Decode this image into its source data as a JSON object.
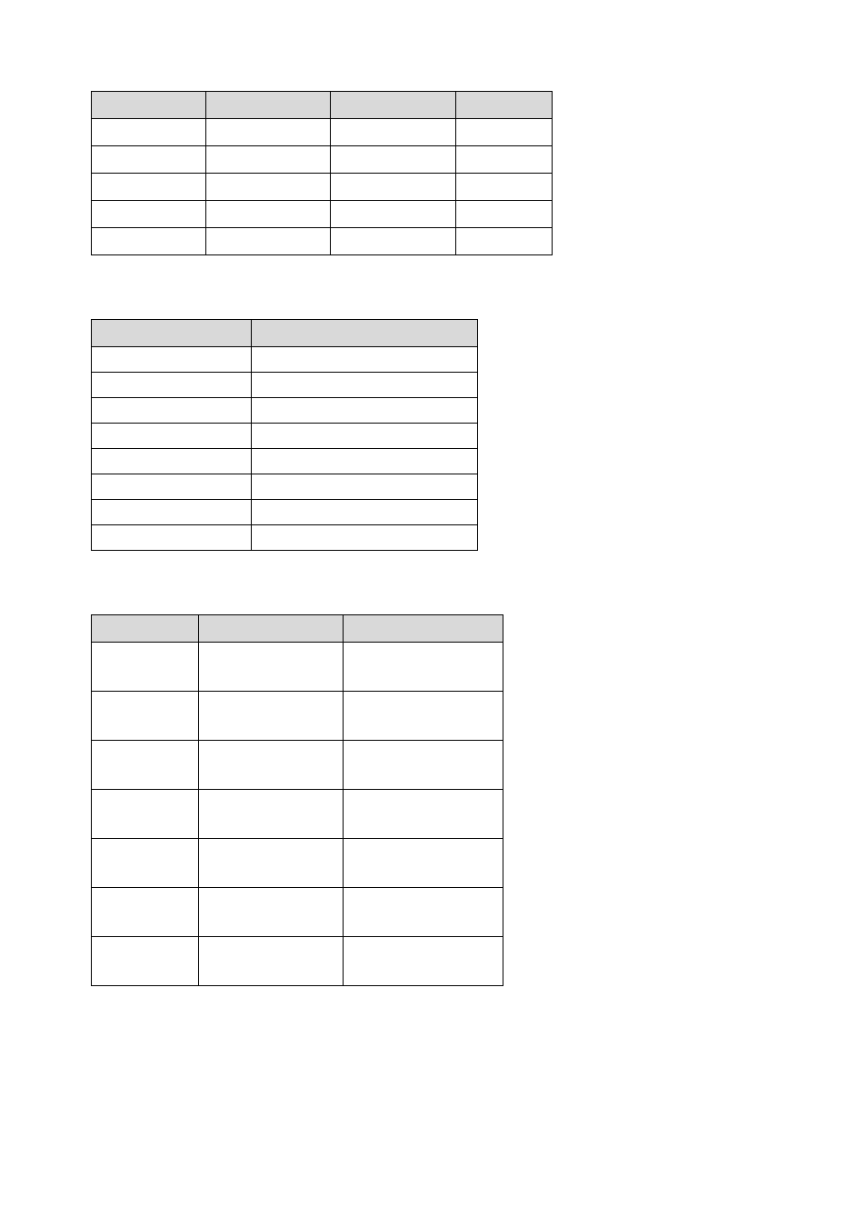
{
  "table1": {
    "headers": [
      "",
      "",
      "",
      ""
    ],
    "rows": [
      [
        "",
        "",
        "",
        ""
      ],
      [
        "",
        "",
        "",
        ""
      ],
      [
        "",
        "",
        "",
        ""
      ],
      [
        "",
        "",
        "",
        ""
      ],
      [
        "",
        "",
        "",
        ""
      ]
    ]
  },
  "table2": {
    "headers": [
      "",
      ""
    ],
    "rows": [
      [
        "",
        ""
      ],
      [
        "",
        ""
      ],
      [
        "",
        ""
      ],
      [
        "",
        ""
      ],
      [
        "",
        ""
      ],
      [
        "",
        ""
      ],
      [
        "",
        ""
      ],
      [
        "",
        ""
      ]
    ]
  },
  "table3": {
    "headers": [
      "",
      "",
      ""
    ],
    "rows": [
      [
        "",
        "",
        ""
      ],
      [
        "",
        "",
        ""
      ],
      [
        "",
        "",
        ""
      ],
      [
        "",
        "",
        ""
      ],
      [
        "",
        "",
        ""
      ],
      [
        "",
        "",
        ""
      ],
      [
        "",
        "",
        ""
      ]
    ]
  }
}
